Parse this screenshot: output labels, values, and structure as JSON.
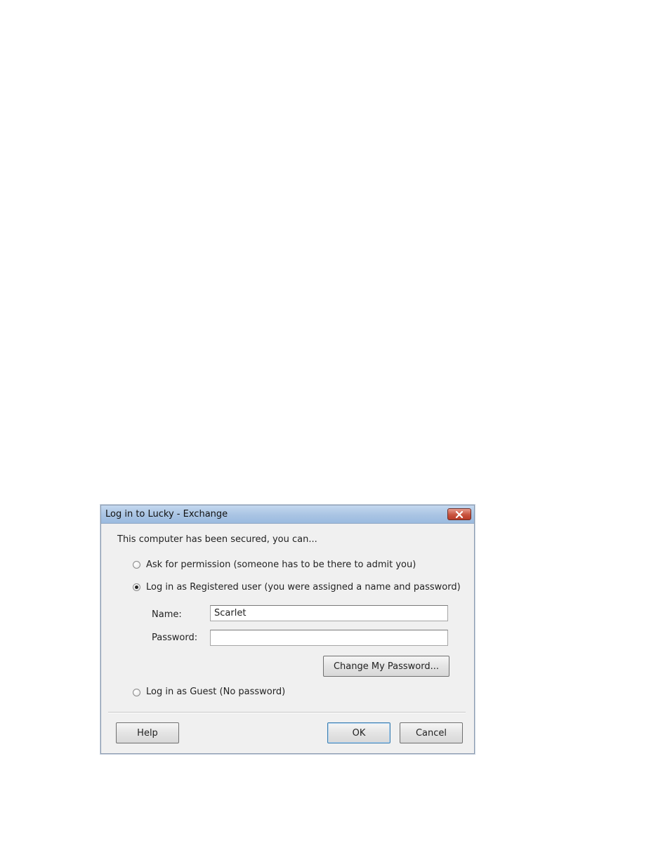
{
  "dialog": {
    "title": "Log in to Lucky - Exchange",
    "close_icon": "close-icon",
    "intro": "This computer has been secured, you can...",
    "options": [
      {
        "label": "Ask for permission (someone has to be there to admit you)",
        "checked": false
      },
      {
        "label": "Log in as Registered user (you were assigned a name and password)",
        "checked": true
      },
      {
        "label": "Log in as Guest (No password)",
        "checked": false
      }
    ],
    "name_label": "Name:",
    "name_value": "Scarlet",
    "password_label": "Password:",
    "password_value": "",
    "change_password_label": "Change My Password...",
    "help_label": "Help",
    "ok_label": "OK",
    "cancel_label": "Cancel"
  },
  "colors": {
    "titlebar": "#a9c4e3",
    "close_button": "#c8543f",
    "dialog_background": "#f0f0f0",
    "page_background": "#ffffff"
  }
}
